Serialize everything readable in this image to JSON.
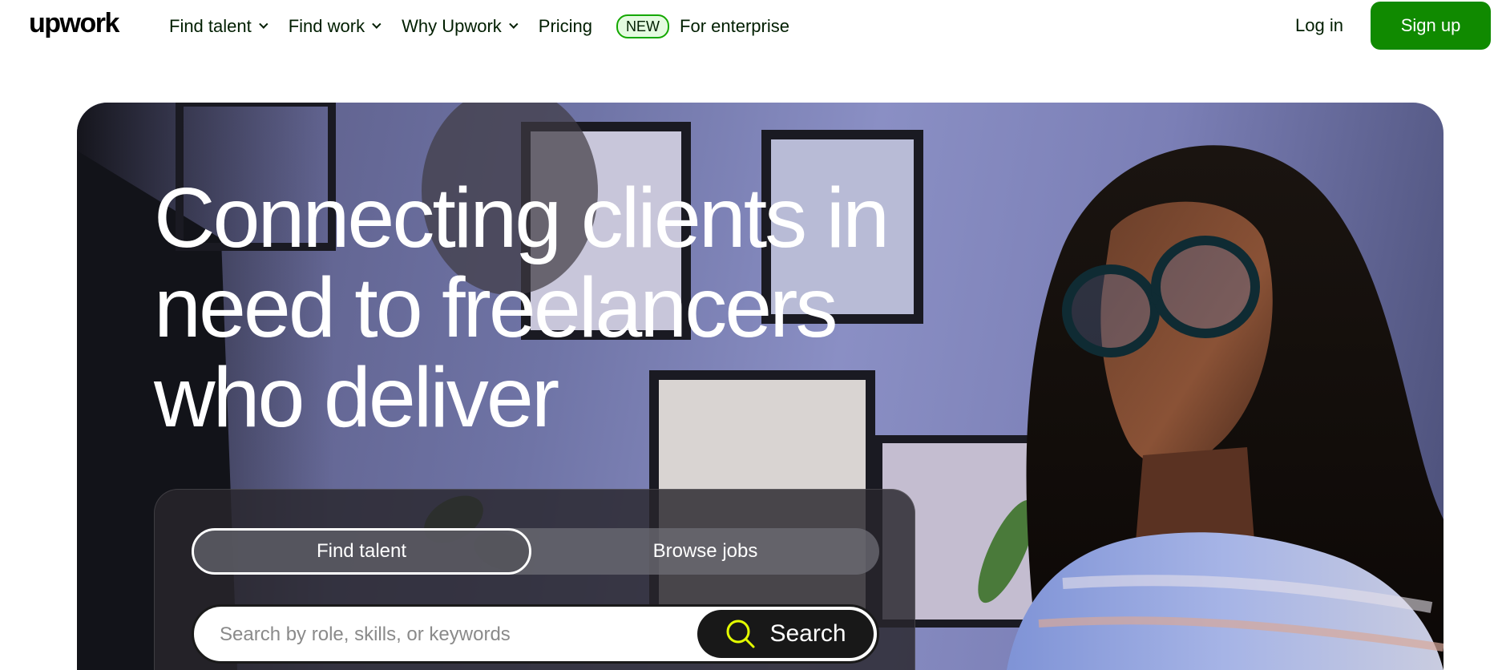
{
  "header": {
    "logo": "upwork",
    "nav": [
      {
        "label": "Find talent",
        "dropdown": true
      },
      {
        "label": "Find work",
        "dropdown": true
      },
      {
        "label": "Why Upwork",
        "dropdown": true
      },
      {
        "label": "Pricing",
        "dropdown": false
      }
    ],
    "new_badge": "NEW",
    "enterprise": "For enterprise",
    "login": "Log in",
    "signup": "Sign up"
  },
  "hero": {
    "title_lines": [
      "Connecting clients in",
      "need to freelancers",
      "who deliver"
    ],
    "tabs": {
      "active": "Find talent",
      "other": "Browse jobs"
    },
    "search": {
      "placeholder": "Search by role, skills, or keywords",
      "value": "",
      "button": "Search"
    }
  },
  "colors": {
    "brand": "#108a00",
    "accent_icon": "#e4ff00",
    "text": "#001e00"
  }
}
